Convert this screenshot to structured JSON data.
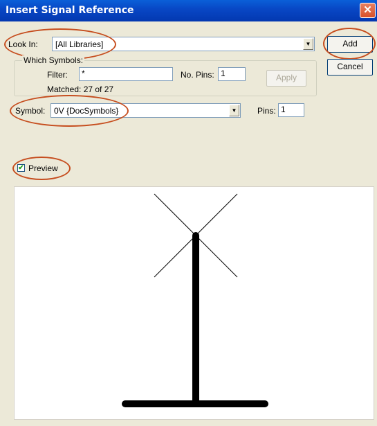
{
  "window": {
    "title": "Insert Signal Reference",
    "close_glyph": "✕"
  },
  "look_in": {
    "label": "Look In:",
    "value": "[All Libraries]"
  },
  "which_symbols": {
    "group_title": "Which Symbols:",
    "filter_label": "Filter:",
    "filter_value": "*",
    "no_pins_label": "No. Pins:",
    "no_pins_value": "1",
    "apply_label": "Apply",
    "matched_text": "Matched: 27 of 27"
  },
  "symbol": {
    "label": "Symbol:",
    "value": "0V {DocSymbols}",
    "pins_label": "Pins:",
    "pins_value": "1"
  },
  "buttons": {
    "add": "Add",
    "cancel": "Cancel"
  },
  "preview": {
    "label": "Preview",
    "checked": true,
    "check_glyph": "✔"
  },
  "colors": {
    "annotation_oval": "#c64d1e",
    "title_bar": "#0846c4"
  }
}
